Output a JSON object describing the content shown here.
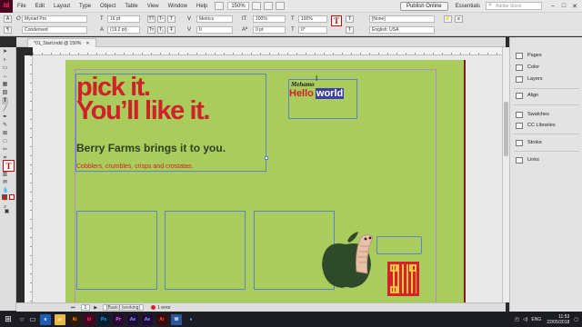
{
  "menubar": {
    "logo": "Id",
    "items": [
      "File",
      "Edit",
      "Layout",
      "Type",
      "Object",
      "Table",
      "View",
      "Window",
      "Help"
    ],
    "zoom": "150%",
    "publish": "Publish Online",
    "workspace": "Essentials",
    "stock_placeholder": "Adobe Stock"
  },
  "control": {
    "font_family": "Myriad Pro",
    "font_style": "Condensed",
    "font_size": "16 pt",
    "leading": "(19.2 pt)",
    "kerning": "Metrics",
    "tracking": "0",
    "horiz_scale": "100%",
    "vert_scale": "100%",
    "baseline": "0 pt",
    "skew": "0°",
    "char_style": "[None]",
    "language": "English: USA"
  },
  "document": {
    "tab_title": "*01_Start.indd @ 150%"
  },
  "page": {
    "headline_1": "pick it.",
    "headline_2": "You’ll like it.",
    "subhead": "Berry Farms brings it to you.",
    "tagline": "Cobblers, crumbles, crisps and crostatas.",
    "hello_small": "Mehamo",
    "hello": "Hello",
    "world": "world"
  },
  "status": {
    "page_num": "1",
    "style": "[Basic] (working)",
    "errors": "1 error"
  },
  "panels": [
    "Pages",
    "Color",
    "Layers",
    "Align",
    "Swatches",
    "CC Libraries",
    "Stroke",
    "Links"
  ],
  "taskbar": {
    "apps": [
      {
        "label": "e",
        "bg": "#1e5fb3",
        "fg": "#ffffff"
      },
      {
        "label": "📁",
        "bg": "#e8b84a",
        "fg": "#5a3c00"
      },
      {
        "label": "Ai",
        "bg": "#2b1a04",
        "fg": "#ff9a00"
      },
      {
        "label": "Id",
        "bg": "#49021f",
        "fg": "#ff3366"
      },
      {
        "label": "Ps",
        "bg": "#001d34",
        "fg": "#31a8ff"
      },
      {
        "label": "Pr",
        "bg": "#2a0634",
        "fg": "#e77cff"
      },
      {
        "label": "Ae",
        "bg": "#1f0b3a",
        "fg": "#9999ff"
      },
      {
        "label": "Ae",
        "bg": "#1f0b3a",
        "fg": "#9999ff"
      },
      {
        "label": "Ar",
        "bg": "#3a0a0a",
        "fg": "#ff4a4a"
      },
      {
        "label": "W",
        "bg": "#2b579a",
        "fg": "#ffffff"
      },
      {
        "label": "●",
        "bg": "#1c1c24",
        "fg": "#4aa3ff"
      }
    ],
    "lang": "ENG",
    "time": "11:53",
    "date": "22/05/2018"
  }
}
